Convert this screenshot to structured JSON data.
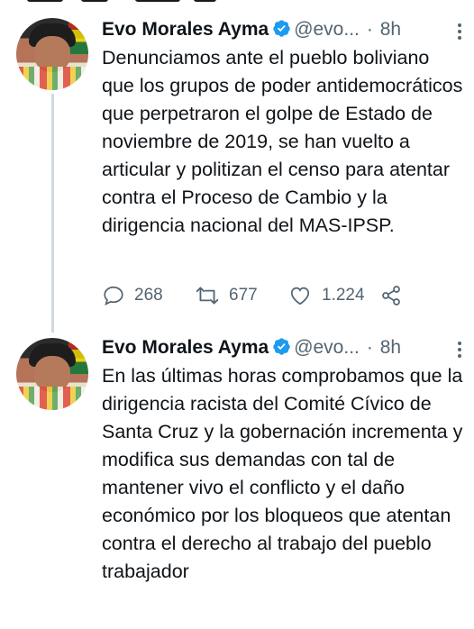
{
  "tweets": [
    {
      "author_name": "Evo Morales Ayma",
      "handle": "@evo...",
      "separator": "·",
      "time": "8h",
      "text": "Denunciamos ante el pueblo boliviano que los grupos de poder antidemocráticos que perpetraron el golpe de Estado de noviembre de 2019, se han vuelto a articular y politizan el censo para atentar contra el Proceso de Cambio y la dirigencia nacional del MAS-IPSP.",
      "replies": "268",
      "retweets": "677",
      "likes": "1.224"
    },
    {
      "author_name": "Evo Morales Ayma",
      "handle": "@evo...",
      "separator": "·",
      "time": "8h",
      "text": "En las últimas horas comprobamos que la dirigencia racista del Comité Cívico de Santa Cruz y la gobernación incrementa y modifica sus demandas con tal de mantener vivo el conflicto y el daño económico por los bloqueos que atentan contra el derecho al trabajo del pueblo trabajador"
    }
  ],
  "icons": {
    "verified": "verified-badge-icon",
    "reply": "reply-icon",
    "retweet": "retweet-icon",
    "like": "heart-icon",
    "share": "share-icon",
    "more": "more-icon"
  },
  "colors": {
    "text": "#0f1419",
    "secondary": "#536471",
    "verified": "#1d9bf0",
    "thread_line": "#cfd9de"
  }
}
